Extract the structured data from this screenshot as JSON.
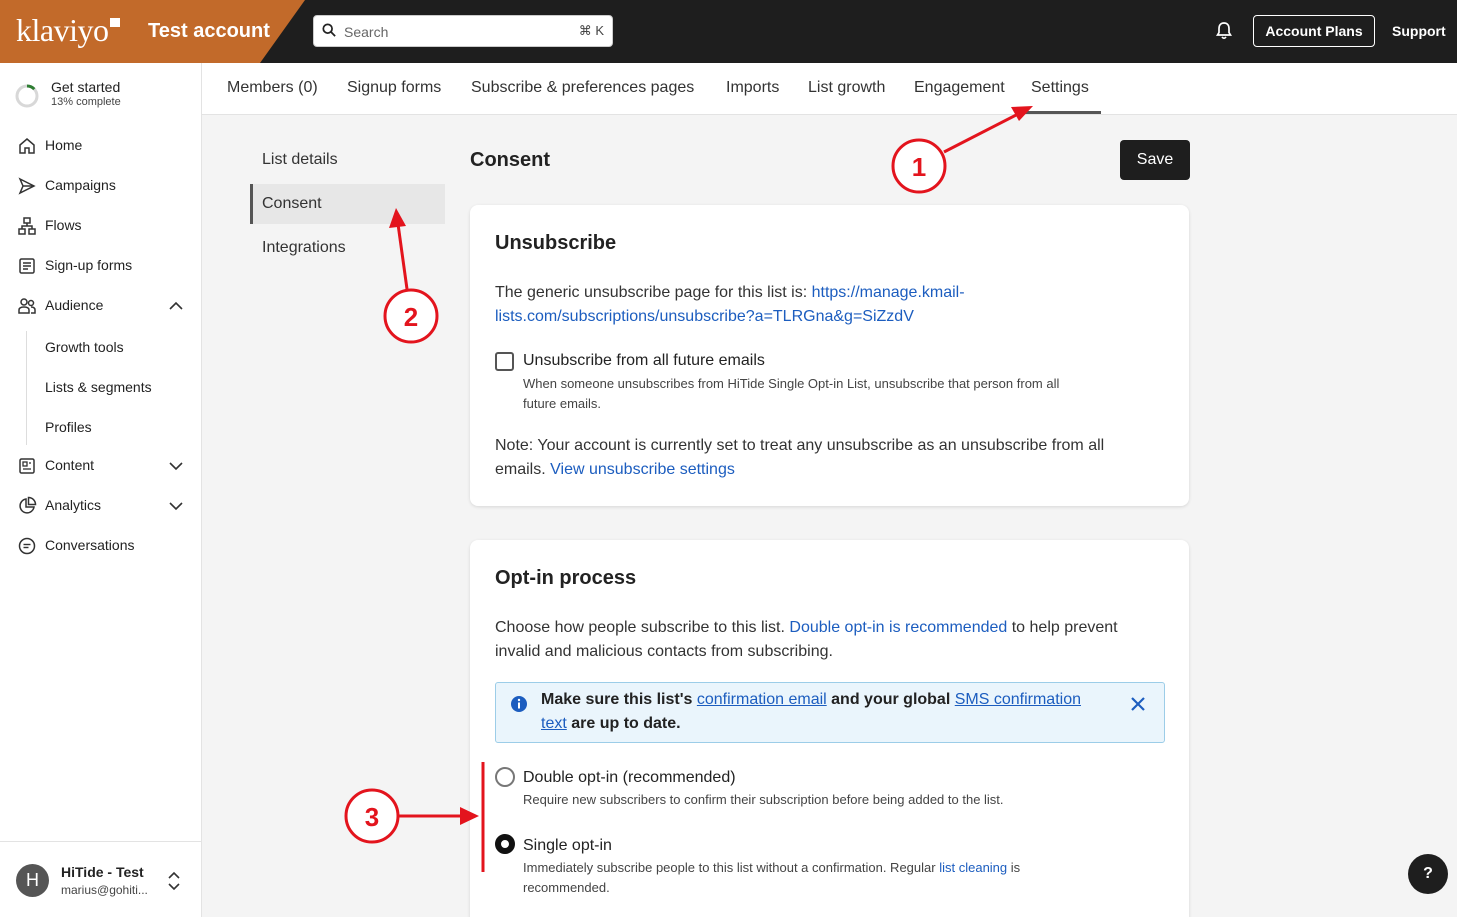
{
  "header": {
    "logo_text": "klaviyo",
    "account_name": "Test account",
    "search_placeholder": "Search",
    "search_shortcut": "⌘ K",
    "account_plans_label": "Account Plans",
    "support_label": "Support"
  },
  "sidebar": {
    "get_started": {
      "title": "Get started",
      "subtitle": "13% complete",
      "progress_fraction": 0.13
    },
    "items": [
      {
        "label": "Home",
        "icon": "home-icon"
      },
      {
        "label": "Campaigns",
        "icon": "send-icon"
      },
      {
        "label": "Flows",
        "icon": "flow-icon"
      },
      {
        "label": "Sign-up forms",
        "icon": "form-icon"
      },
      {
        "label": "Audience",
        "icon": "people-icon"
      },
      {
        "label": "Content",
        "icon": "content-icon"
      },
      {
        "label": "Analytics",
        "icon": "analytics-icon"
      },
      {
        "label": "Conversations",
        "icon": "chat-icon"
      }
    ],
    "audience_subitems": [
      "Growth tools",
      "Lists & segments",
      "Profiles"
    ],
    "user": {
      "initial": "H",
      "name": "HiTide - Test",
      "email": "marius@gohiti..."
    }
  },
  "tabs": [
    "Members (0)",
    "Signup forms",
    "Subscribe & preferences pages",
    "Imports",
    "List growth",
    "Engagement",
    "Settings"
  ],
  "active_tab": "Settings",
  "settings_nav": [
    "List details",
    "Consent",
    "Integrations"
  ],
  "active_settings_nav": "Consent",
  "main": {
    "title": "Consent",
    "save_label": "Save",
    "unsubscribe": {
      "title": "Unsubscribe",
      "intro": "The generic unsubscribe page for this list is:",
      "url_line1": "https://manage.kmail-",
      "url_line2": "lists.com/subscriptions/unsubscribe?a=TLRGna&g=SiZzdV",
      "checkbox_label": "Unsubscribe from all future emails",
      "checkbox_checked": false,
      "checkbox_desc_line1": "When someone unsubscribes from HiTide Single Opt-in List, unsubscribe that person from all",
      "checkbox_desc_line2": "future emails.",
      "note_line1": "Note: Your account is currently set to treat any unsubscribe as an unsubscribe from all",
      "note_line2_prefix": "emails.",
      "note_link": "View unsubscribe settings"
    },
    "optin": {
      "title": "Opt-in process",
      "desc_prefix": "Choose how people subscribe to this list.",
      "desc_link": "Double opt-in is recommended",
      "desc_suffix": "to help prevent",
      "desc_line2": "invalid and malicious contacts from subscribing.",
      "info": {
        "part1": "Make sure this list's",
        "link1": "confirmation email",
        "part2": "and your global",
        "link2a": "SMS confirmation",
        "link2b": "text",
        "part3": "are up to date."
      },
      "options": [
        {
          "label": "Double opt-in (recommended)",
          "desc": "Require new subscribers to confirm their subscription before being added to the list.",
          "selected": false
        },
        {
          "label": "Single opt-in",
          "desc_prefix": "Immediately subscribe people to this list without a confirmation. Regular",
          "desc_link": "list cleaning",
          "desc_suffix": "is",
          "desc_line2": "recommended.",
          "selected": true
        }
      ]
    }
  },
  "annotations": [
    "1",
    "2",
    "3"
  ],
  "help_label": "?",
  "colors": {
    "brand": "#c26a2a",
    "topbar": "#1e1e1e",
    "link": "#1c5dbf",
    "annotation": "#e3141d"
  }
}
